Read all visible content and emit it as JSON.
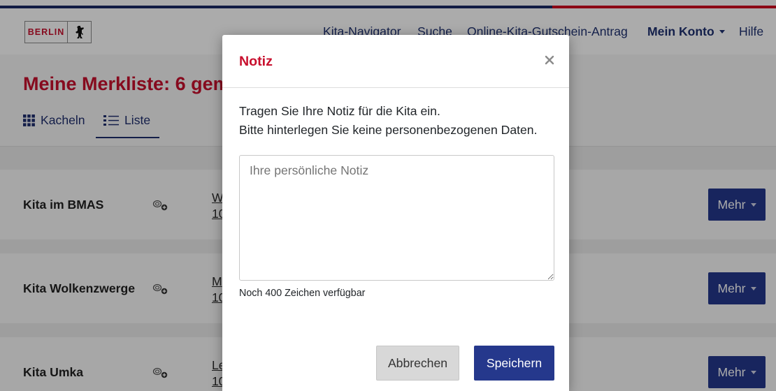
{
  "header": {
    "logo_text": "BERLIN",
    "logo_icon": "berlin-bear-icon",
    "nav": [
      {
        "label": "Kita-Navigator"
      },
      {
        "label": "Suche"
      },
      {
        "label": "Online-Kita-Gutschein-Antrag"
      },
      {
        "label": "Mein Konto",
        "icon": "chevron-down-icon"
      },
      {
        "label": "Hilfe"
      }
    ]
  },
  "page": {
    "title": "Meine Merkliste: 6 gem",
    "view_tabs": [
      {
        "label": "Kacheln",
        "icon": "grid-icon",
        "active": false
      },
      {
        "label": "Liste",
        "icon": "list-icon",
        "active": true
      }
    ]
  },
  "list": {
    "row_icon": "eye-add-icon",
    "rows": [
      {
        "name": "Kita im BMAS",
        "address_line1": "W",
        "address_line2": "10",
        "more_label": "Mehr"
      },
      {
        "name": "Kita Wolkenzwerge",
        "address_line1": "M",
        "address_line2": "10",
        "more_label": "Mehr"
      },
      {
        "name": "Kita Umka",
        "address_line1": "Le",
        "address_line2": "10",
        "more_label": "Mehr"
      }
    ]
  },
  "modal": {
    "title": "Notiz",
    "close_icon": "close-icon",
    "intro_line1": "Tragen Sie Ihre Notiz für die Kita ein.",
    "intro_line2": "Bitte hinterlegen Sie keine personenbezogenen Daten.",
    "note_field": {
      "value": "",
      "placeholder": "Ihre persönliche Notiz"
    },
    "char_counter": "Noch 400 Zeichen verfügbar",
    "cancel_label": "Abbrechen",
    "save_label": "Speichern"
  },
  "colors": {
    "brand_red": "#c8102e",
    "navy": "#1f2e6e",
    "primary_button": "#25388c",
    "secondary_button": "#d8d8d8",
    "nav_link": "#1e3170"
  }
}
